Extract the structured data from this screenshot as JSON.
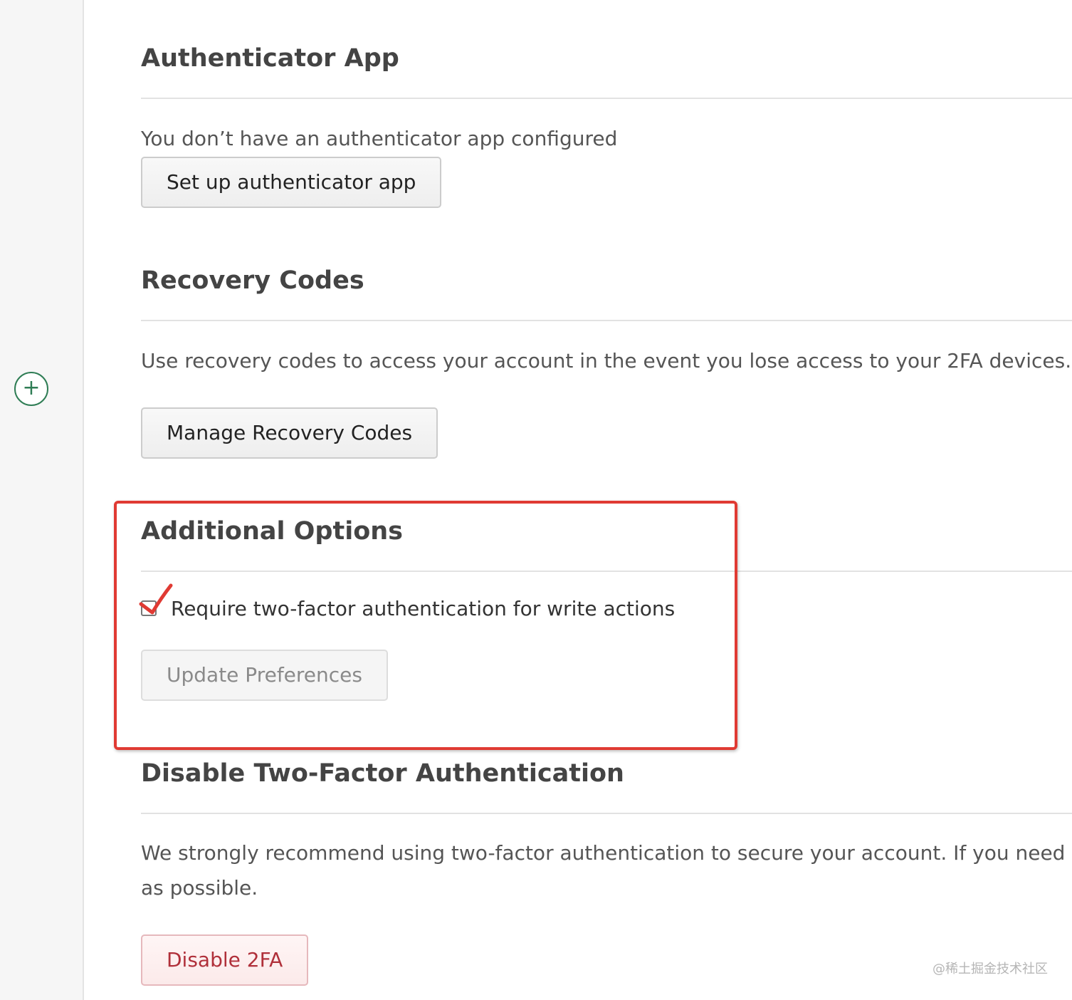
{
  "sidebar": {
    "add_icon": "plus-circle-icon",
    "add_glyph": "+"
  },
  "authenticator": {
    "title": "Authenticator App",
    "status_text": "You don’t have an authenticator app configured",
    "setup_button": "Set up authenticator app"
  },
  "recovery": {
    "title": "Recovery Codes",
    "description": "Use recovery codes to access your account in the event you lose access to your 2FA devices.",
    "manage_button": "Manage Recovery Codes"
  },
  "additional": {
    "title": "Additional Options",
    "checkbox_label": "Require two-factor authentication for write actions",
    "checkbox_checked": false,
    "update_button": "Update Preferences",
    "update_button_disabled": true
  },
  "disable": {
    "title": "Disable Two-Factor Authentication",
    "description_line1": "We strongly recommend using two-factor authentication to secure your account. If you need to disa",
    "description_line2": "as possible.",
    "disable_button": "Disable 2FA"
  },
  "annotation": {
    "box_color": "#e03a33",
    "check_color": "#e03a33"
  },
  "watermark": "@稀土掘金技术社区",
  "colors": {
    "accent_green": "#2f7d55",
    "danger": "#b0303a"
  }
}
